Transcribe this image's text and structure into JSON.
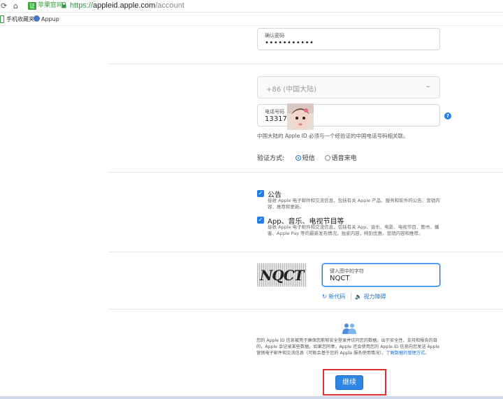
{
  "browser": {
    "cert_label": "苹果官网",
    "url_scheme": "https://",
    "url_host": "appleid.apple.com",
    "url_path": "/account",
    "bookmarks": [
      "手机收藏夹",
      "Appup"
    ]
  },
  "form": {
    "confirm_password": {
      "label": "确认密码",
      "value": "•••••••••••"
    },
    "country_select": {
      "value": "+86 (中国大陆)"
    },
    "phone": {
      "label": "电话号码",
      "value": "133174"
    },
    "phone_note": "中国大陆的 Apple ID 必须与一个经验证的中国电话号码相关联。",
    "verify_method": {
      "label": "验证方式:",
      "options": [
        "短信",
        "语音来电"
      ],
      "selected": "短信"
    },
    "subscriptions": [
      {
        "title": "公告",
        "desc": "接收 Apple 电子邮件和交流信息，包括有关 Apple 产品、服务和软件的公告、营销内容、推荐和更新。",
        "checked": true
      },
      {
        "title": "App、音乐、电视节目等",
        "desc": "接收 Apple 电子邮件和交流信息，包括有关 App、音乐、电影、电视节目、图书、播客、Apple Pay 等的最新发布情况，独家内容，特别优惠，营销内容和推荐。",
        "checked": true
      }
    ],
    "captcha": {
      "image_text": "NQCT",
      "input_label": "键入图中的字符",
      "input_value": "NQCT",
      "new_code": "新代码",
      "vision_impaired": "视力障碍"
    },
    "privacy_text": "您的 Apple ID 信息被用于确保您能够安全登录并访问您的数据。出于安全性、支持和报告的目的，Apple 会记录某些数据。如果您同意，Apple 还会使用您的 Apple ID 信息向您发送 Apple 营销电子邮件和交流信息（可能会基于您的 Apple 服务使用情况）。",
    "privacy_link": "了解数据的管理方式。",
    "continue_label": "继续"
  },
  "colors": {
    "accent": "#1f7ee8",
    "highlight_frame": "#e03030",
    "cert_green": "#38a838"
  }
}
